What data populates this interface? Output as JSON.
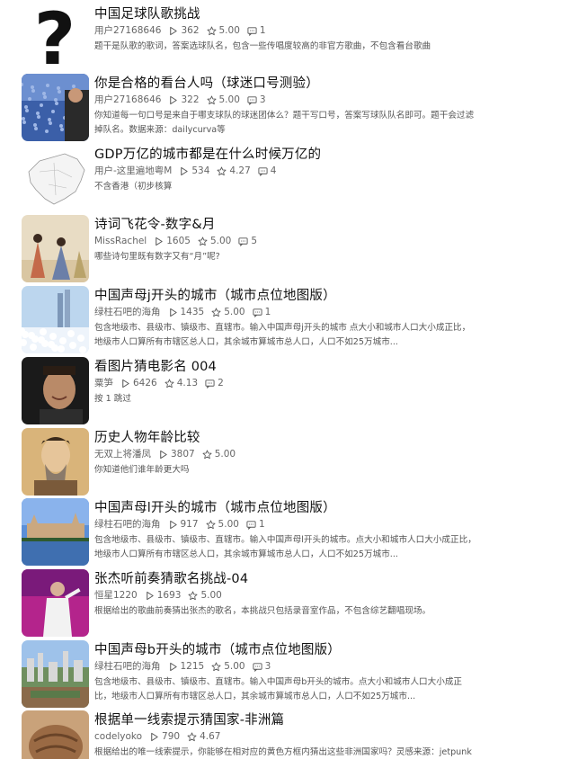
{
  "items": [
    {
      "title": "中国足球队歌挑战",
      "author": "用户27168646",
      "plays": "362",
      "rating": "5.00",
      "comments": "1",
      "desc": [
        "题干是队歌的歌词，答案选球队名，包含一些传唱度较高的非官方歌曲，不包含看台歌曲"
      ]
    },
    {
      "title": "你是合格的看台人吗（球迷口号测验）",
      "author": "用户27168646",
      "plays": "322",
      "rating": "5.00",
      "comments": "3",
      "desc": [
        "你知道每一句口号是来自于哪支球队的球迷团体么？题干写口号，答案写球队队名即可。题干会过滤",
        "掉队名。数据来源：dailycurva等"
      ]
    },
    {
      "title": "GDP万亿的城市都是在什么时候万亿的",
      "author": "用户-这里遍地粤M",
      "plays": "534",
      "rating": "4.27",
      "comments": "4",
      "desc": [
        "不含香港（初步核算"
      ]
    },
    {
      "title": "诗词飞花令-数字&月",
      "author": "MissRachel",
      "plays": "1605",
      "rating": "5.00",
      "comments": "5",
      "desc": [
        "哪些诗句里既有数字又有“月”呢?"
      ]
    },
    {
      "title": "中国声母j开头的城市（城市点位地图版）",
      "author": "绿柱石吧的海角",
      "plays": "1435",
      "rating": "5.00",
      "comments": "1",
      "desc": [
        "包含地级市、县级市、镇级市、直辖市。输入中国声母j开头的城市 点大小和城市人口大小成正比，",
        "地级市人口算所有市辖区总人口，其余城市算城市总人口，人口不如25万城市..."
      ]
    },
    {
      "title": "看图片猜电影名 004",
      "author": "粟笋",
      "plays": "6426",
      "rating": "4.13",
      "comments": "2",
      "desc": [
        "按 1 跳过"
      ]
    },
    {
      "title": "历史人物年龄比较",
      "author": "无双上将潘凤",
      "plays": "3807",
      "rating": "5.00",
      "comments": "",
      "desc": [
        "你知道他们谁年龄更大吗"
      ]
    },
    {
      "title": "中国声母l开头的城市（城市点位地图版）",
      "author": "绿柱石吧的海角",
      "plays": "917",
      "rating": "5.00",
      "comments": "1",
      "desc": [
        "包含地级市、县级市、镇级市、直辖市。输入中国声母l开头的城市。点大小和城市人口大小成正比，",
        "地级市人口算所有市辖区总人口，其余城市算城市总人口，人口不如25万城市..."
      ]
    },
    {
      "title": "张杰听前奏猜歌名挑战-04",
      "author": "恒星1220",
      "plays": "1693",
      "rating": "5.00",
      "comments": "",
      "desc": [
        "根据给出的歌曲前奏猜出张杰的歌名，本挑战只包括录音室作品，不包含综艺翻唱现场。"
      ]
    },
    {
      "title": "中国声母b开头的城市（城市点位地图版）",
      "author": "绿柱石吧的海角",
      "plays": "1215",
      "rating": "5.00",
      "comments": "3",
      "desc": [
        "包含地级市、县级市、镇级市、直辖市。输入中国声母b开头的城市。点大小和城市人口大小成正",
        "比，地级市人口算所有市辖区总人口，其余城市算城市总人口，人口不如25万城市..."
      ]
    },
    {
      "title": "根据单一线索提示猜国家-非洲篇",
      "author": "codelyoko",
      "plays": "790",
      "rating": "4.67",
      "comments": "",
      "desc": [
        "根据给出的唯一线索提示，你能够在相对应的黄色方框内猜出这些非洲国家吗？灵感来源：jetpunk"
      ]
    }
  ],
  "thumbs": [
    "question-mark",
    "stadium-crowd",
    "china-map",
    "ancient-painting",
    "snowy-city",
    "movie-actor",
    "historical-portrait",
    "castle-lake",
    "singer-stage",
    "city-skyline",
    "africa-artifact"
  ],
  "colors": {
    "title": "#111111",
    "meta": "#666666",
    "desc": "#555555"
  }
}
